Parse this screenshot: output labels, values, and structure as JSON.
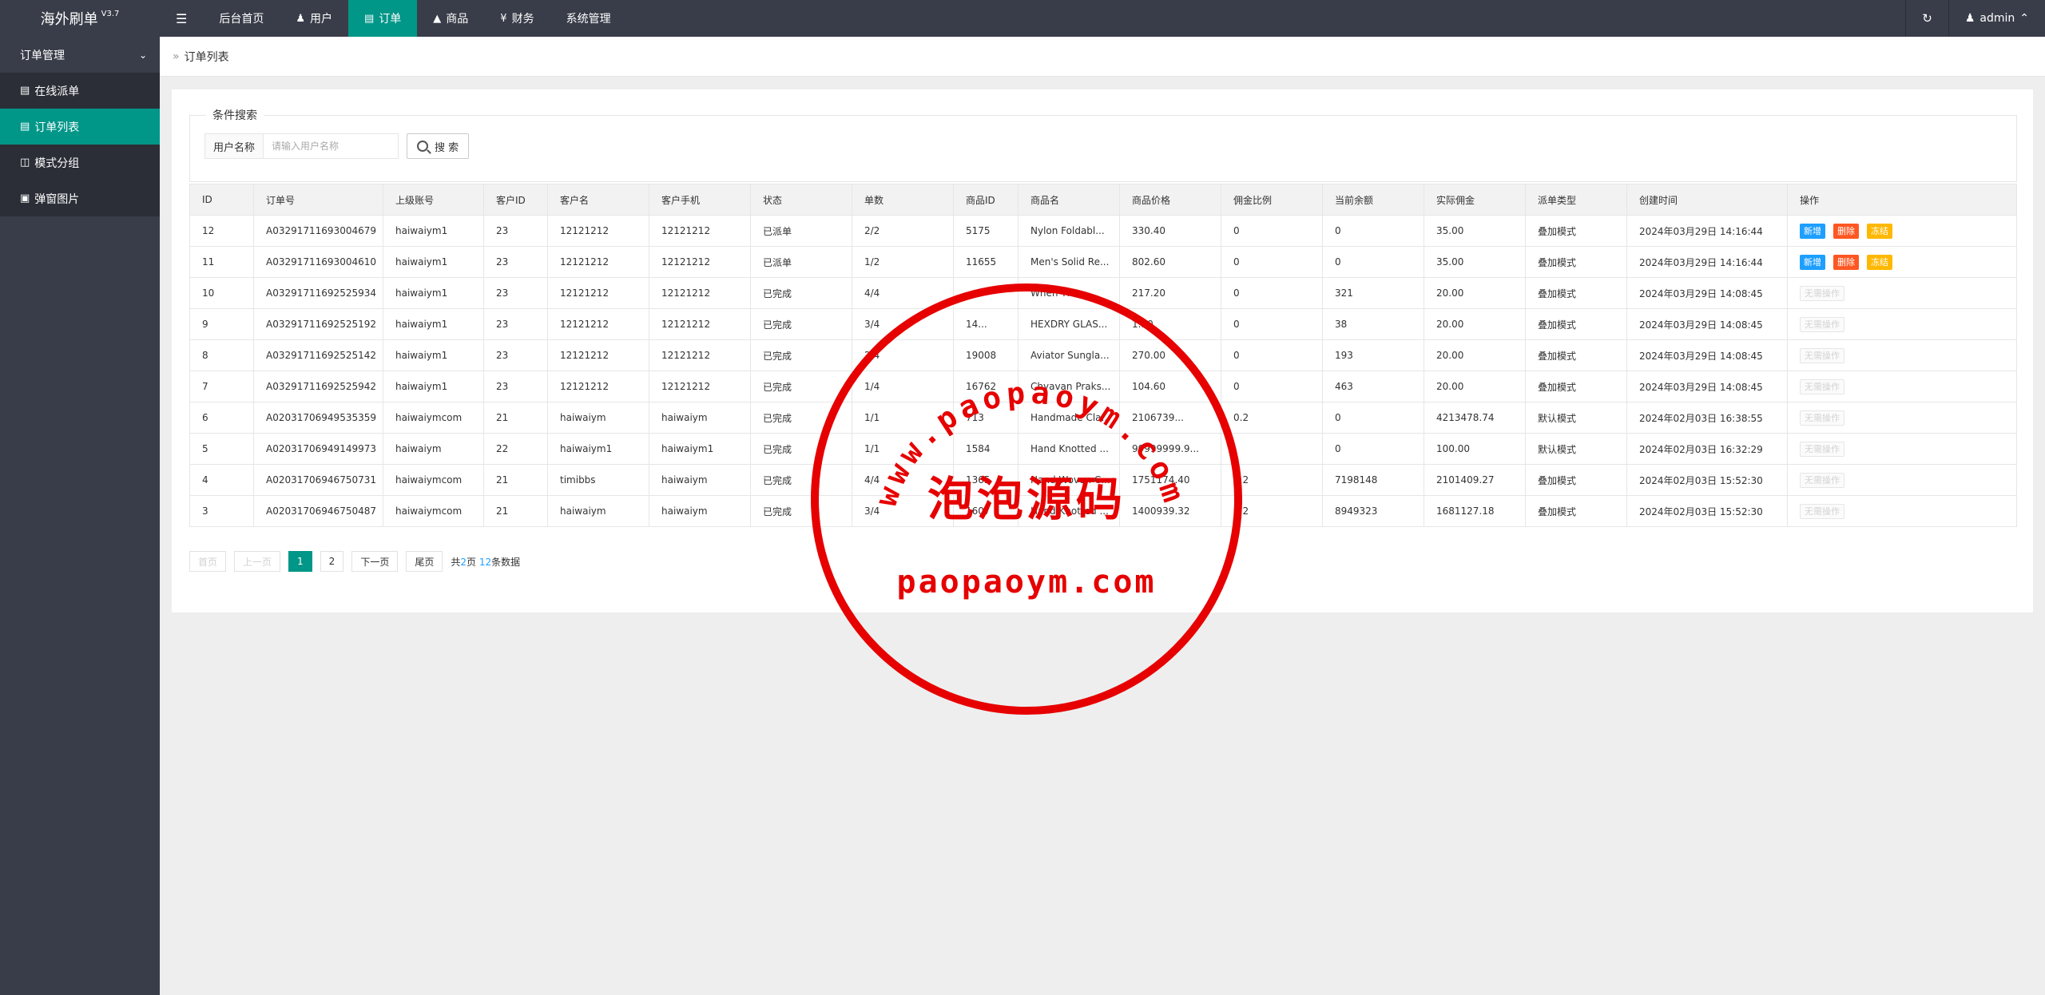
{
  "app": {
    "title": "海外刷单",
    "version": "V3.7"
  },
  "topnav": {
    "toggle_icon": "menu-icon",
    "items": [
      {
        "label": "后台首页",
        "icon": ""
      },
      {
        "label": "用户",
        "icon": "user-icon"
      },
      {
        "label": "订单",
        "icon": "document-icon",
        "active": true
      },
      {
        "label": "商品",
        "icon": "cart-icon"
      },
      {
        "label": "财务",
        "icon": "yen-icon"
      },
      {
        "label": "系统管理",
        "icon": ""
      }
    ],
    "refresh_icon": "refresh-icon",
    "user": "admin"
  },
  "sidebar": {
    "group": "订单管理",
    "items": [
      {
        "label": "在线派单",
        "icon": "document-icon"
      },
      {
        "label": "订单列表",
        "icon": "list-icon",
        "active": true
      },
      {
        "label": "模式分组",
        "icon": "group-icon"
      },
      {
        "label": "弹窗图片",
        "icon": "image-icon"
      }
    ]
  },
  "breadcrumb": {
    "current": "订单列表"
  },
  "search": {
    "legend": "条件搜索",
    "label": "用户名称",
    "placeholder": "请输入用户名称",
    "value": "",
    "button": "搜 索"
  },
  "table": {
    "columns": [
      "ID",
      "订单号",
      "上级账号",
      "客户ID",
      "客户名",
      "客户手机",
      "状态",
      "单数",
      "商品ID",
      "商品名",
      "商品价格",
      "佣金比例",
      "当前余额",
      "实际佣金",
      "派单类型",
      "创建时间",
      "操作"
    ],
    "rows": [
      {
        "id": "12",
        "order_no": "A03291711693004679",
        "parent": "haiwaiym1",
        "cid": "23",
        "cname": "12121212",
        "phone": "12121212",
        "status": "已派单",
        "status_kind": "dispatched",
        "count": "2/2",
        "pid": "5175",
        "pname": "Nylon Foldabl...",
        "price": "330.40",
        "ratio": "0",
        "balance": "0",
        "commission": "35.00",
        "type": "叠加模式",
        "created": "2024年03月29日 14:16:44",
        "actions": [
          "新增",
          "删除",
          "冻结"
        ]
      },
      {
        "id": "11",
        "order_no": "A03291711693004610",
        "parent": "haiwaiym1",
        "cid": "23",
        "cname": "12121212",
        "phone": "12121212",
        "status": "已派单",
        "status_kind": "dispatched",
        "count": "1/2",
        "pid": "11655",
        "pname": "Men's Solid Re...",
        "price": "802.60",
        "ratio": "0",
        "balance": "0",
        "commission": "35.00",
        "type": "叠加模式",
        "created": "2024年03月29日 14:16:44",
        "actions": [
          "新增",
          "删除",
          "冻结"
        ]
      },
      {
        "id": "10",
        "order_no": "A03291711692525934",
        "parent": "haiwaiym1",
        "cid": "23",
        "cname": "12121212",
        "phone": "12121212",
        "status": "已完成",
        "status_kind": "done",
        "count": "4/4",
        "pid": "",
        "pname": "When Th...",
        "price": "217.20",
        "ratio": "0",
        "balance": "321",
        "commission": "20.00",
        "type": "叠加模式",
        "created": "2024年03月29日 14:08:45",
        "actions": []
      },
      {
        "id": "9",
        "order_no": "A03291711692525192",
        "parent": "haiwaiym1",
        "cid": "23",
        "cname": "12121212",
        "phone": "12121212",
        "status": "已完成",
        "status_kind": "done",
        "count": "3/4",
        "pid": "14...",
        "pname": "HEXDRY GLAS...",
        "price": "1...0",
        "ratio": "0",
        "balance": "38",
        "commission": "20.00",
        "type": "叠加模式",
        "created": "2024年03月29日 14:08:45",
        "actions": []
      },
      {
        "id": "8",
        "order_no": "A03291711692525142",
        "parent": "haiwaiym1",
        "cid": "23",
        "cname": "12121212",
        "phone": "12121212",
        "status": "已完成",
        "status_kind": "done",
        "count": "2/4",
        "pid": "19008",
        "pname": "Aviator Sungla...",
        "price": "270.00",
        "ratio": "0",
        "balance": "193",
        "commission": "20.00",
        "type": "叠加模式",
        "created": "2024年03月29日 14:08:45",
        "actions": []
      },
      {
        "id": "7",
        "order_no": "A03291711692525942",
        "parent": "haiwaiym1",
        "cid": "23",
        "cname": "12121212",
        "phone": "12121212",
        "status": "已完成",
        "status_kind": "done",
        "count": "1/4",
        "pid": "16762",
        "pname": "Chyavan Praks...",
        "price": "104.60",
        "ratio": "0",
        "balance": "463",
        "commission": "20.00",
        "type": "叠加模式",
        "created": "2024年03月29日 14:08:45",
        "actions": []
      },
      {
        "id": "6",
        "order_no": "A02031706949535359",
        "parent": "haiwaiymcom",
        "cid": "21",
        "cname": "haiwaiym",
        "phone": "haiwaiym",
        "status": "已完成",
        "status_kind": "done",
        "count": "1/1",
        "pid": "713",
        "pname": "Handmade Cla...",
        "price": "2106739...",
        "ratio": "0.2",
        "balance": "0",
        "commission": "4213478.74",
        "type": "默认模式",
        "created": "2024年02月03日 16:38:55",
        "actions": []
      },
      {
        "id": "5",
        "order_no": "A02031706949149973",
        "parent": "haiwaiym",
        "cid": "22",
        "cname": "haiwaiym1",
        "phone": "haiwaiym1",
        "status": "已完成",
        "status_kind": "done",
        "count": "1/1",
        "pid": "1584",
        "pname": "Hand Knotted ...",
        "price": "99999999.9...",
        "ratio": "",
        "balance": "0",
        "commission": "100.00",
        "type": "默认模式",
        "created": "2024年02月03日 16:32:29",
        "actions": []
      },
      {
        "id": "4",
        "order_no": "A02031706946750731",
        "parent": "haiwaiymcom",
        "cid": "21",
        "cname": "timibbs",
        "phone": "haiwaiym",
        "status": "已完成",
        "status_kind": "done",
        "count": "4/4",
        "pid": "1365",
        "pname": "Hand Woven C...",
        "price": "1751174.40",
        "ratio": "0.2",
        "balance": "7198148",
        "commission": "2101409.27",
        "type": "叠加模式",
        "created": "2024年02月03日 15:52:30",
        "actions": []
      },
      {
        "id": "3",
        "order_no": "A02031706946750487",
        "parent": "haiwaiymcom",
        "cid": "21",
        "cname": "haiwaiym",
        "phone": "haiwaiym",
        "status": "已完成",
        "status_kind": "done",
        "count": "3/4",
        "pid": "1607",
        "pname": "Hand Knotted ...",
        "price": "1400939.32",
        "ratio": "0.2",
        "balance": "8949323",
        "commission": "1681127.18",
        "type": "叠加模式",
        "created": "2024年02月03日 15:52:30",
        "actions": []
      }
    ],
    "no_action_label": "无需操作"
  },
  "pager": {
    "first": "首页",
    "prev": "上一页",
    "pages": [
      "1",
      "2"
    ],
    "current": "1",
    "next": "下一页",
    "last": "尾页",
    "info_prefix": "共",
    "total_pages": "2",
    "info_mid": "页",
    "total_items": "12",
    "info_suffix": "条数据"
  },
  "watermark": {
    "arc_text": "www.paopaoym.com",
    "center_text": "泡泡源码",
    "bottom_text": "paopaoym.com",
    "color": "#e60000"
  },
  "colors": {
    "topbar": "#393d49",
    "accent": "#009688",
    "dispatched": "#a233c6",
    "done": "#5fb878",
    "link": "#1e9fff",
    "btn_add": "#1e9fff",
    "btn_del": "#ff5722",
    "btn_freeze": "#ffb800"
  }
}
